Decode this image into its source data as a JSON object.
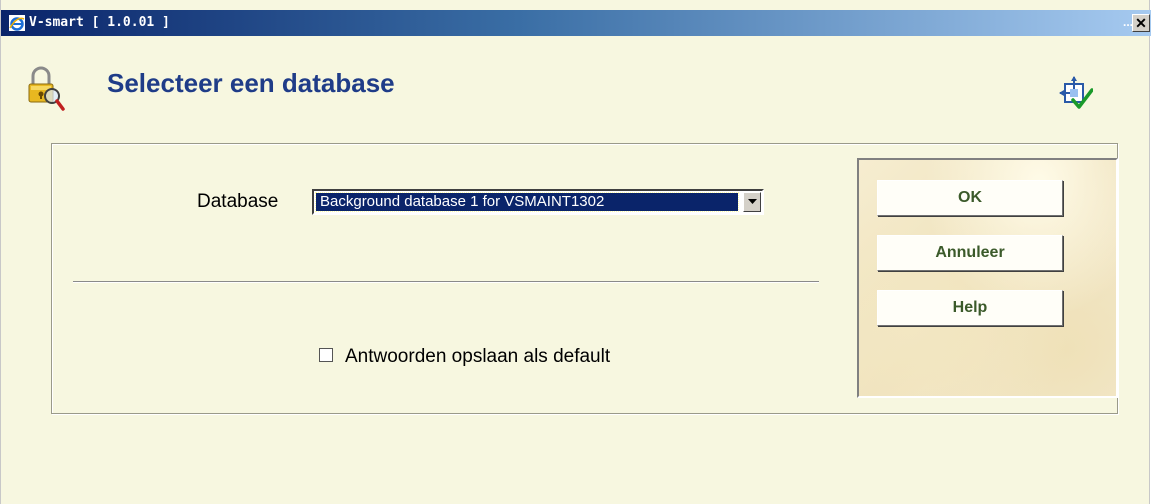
{
  "window": {
    "title": "V-smart [ 1.0.01 ]",
    "minimize_label": "...",
    "close_label": "✕"
  },
  "header": {
    "title": "Selecteer een database"
  },
  "form": {
    "database_label": "Database",
    "database_value": "Background database 1 for VSMAINT1302",
    "save_default_label": "Antwoorden opslaan als default",
    "save_default_checked": false
  },
  "buttons": {
    "ok": "OK",
    "cancel": "Annuleer",
    "help": "Help"
  },
  "colors": {
    "title_color": "#1f3c88",
    "background": "#f7f7e0",
    "button_text": "#3b5a2a",
    "selection": "#0a246a"
  },
  "icons": {
    "app": "ie-icon",
    "header": "lock-magnifier-icon",
    "corner": "preferences-check-icon",
    "dropdown": "chevron-down-icon"
  }
}
